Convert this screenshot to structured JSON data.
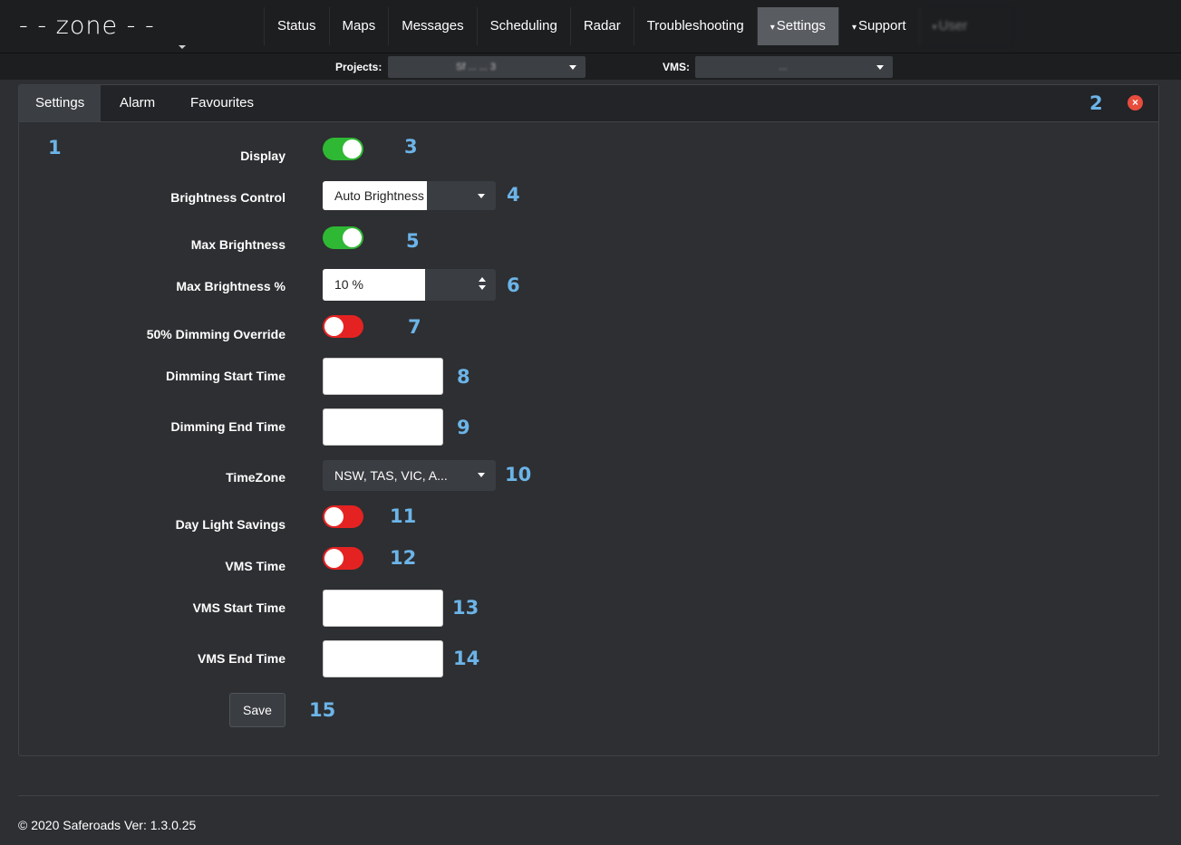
{
  "app": {
    "logo_text": "- - zone - -",
    "copyright": "© 2020 Saferoads Ver: 1.3.0.25"
  },
  "nav": {
    "items": [
      {
        "label": "Status"
      },
      {
        "label": "Maps"
      },
      {
        "label": "Messages"
      },
      {
        "label": "Scheduling"
      },
      {
        "label": "Radar"
      },
      {
        "label": "Troubleshooting"
      },
      {
        "label": "Settings",
        "dropdown": true,
        "active": true
      },
      {
        "label": "Support",
        "dropdown": true
      },
      {
        "label": "User",
        "dropdown": true,
        "redacted": true
      }
    ],
    "caret": "▾"
  },
  "filters": {
    "projects_label": "Projects:",
    "projects_value": "Sf ... ... 3",
    "vms_label": "VMS:",
    "vms_value": "..."
  },
  "tabs": [
    {
      "label": "Settings",
      "active": true
    },
    {
      "label": "Alarm"
    },
    {
      "label": "Favourites"
    }
  ],
  "close_icon_glyph": "×",
  "annotations": [
    "1",
    "2",
    "3",
    "4",
    "5",
    "6",
    "7",
    "8",
    "9",
    "10",
    "11",
    "12",
    "13",
    "14",
    "15"
  ],
  "form": {
    "display_label": "Display",
    "display_on": true,
    "brightness_control_label": "Brightness Control",
    "brightness_control_value": "Auto Brightness",
    "max_brightness_label": "Max Brightness",
    "max_brightness_on": true,
    "max_brightness_pct_label": "Max Brightness %",
    "max_brightness_pct_value": "10 %",
    "dimming_override_label": "50% Dimming Override",
    "dimming_override_on": false,
    "dimming_start_label": "Dimming Start Time",
    "dimming_start_value": "",
    "dimming_end_label": "Dimming End Time",
    "dimming_end_value": "",
    "timezone_label": "TimeZone",
    "timezone_value": "NSW, TAS, VIC, A...",
    "daylight_label": "Day Light Savings",
    "daylight_on": false,
    "vms_time_label": "VMS Time",
    "vms_time_on": false,
    "vms_start_label": "VMS Start Time",
    "vms_start_value": "",
    "vms_end_label": "VMS End Time",
    "vms_end_value": "",
    "save_label": "Save"
  },
  "colors": {
    "toggle_on": "#2fb834",
    "toggle_off": "#e52222",
    "annotation": "#6cb4e8",
    "close": "#e74c3c"
  }
}
